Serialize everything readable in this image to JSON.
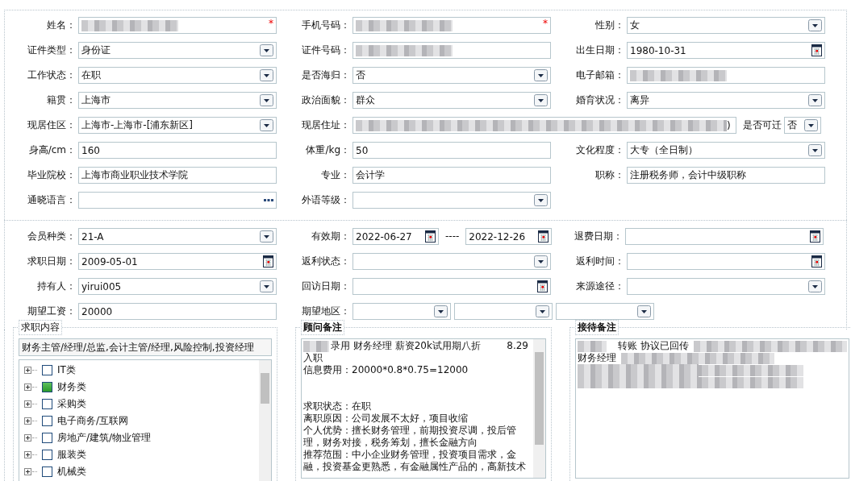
{
  "profile": {
    "rows": [
      {
        "cells": [
          {
            "label": "姓名：",
            "fields": [
              {
                "kind": "text",
                "redacted": true,
                "required_mark": "*"
              }
            ]
          },
          {
            "label": "手机号码：",
            "fields": [
              {
                "kind": "text",
                "redacted": true,
                "required_mark": "*"
              }
            ]
          },
          {
            "label": "性别：",
            "fields": [
              {
                "kind": "select",
                "value": "女"
              }
            ]
          }
        ]
      },
      {
        "cells": [
          {
            "label": "证件类型：",
            "fields": [
              {
                "kind": "select",
                "value": "身份证"
              }
            ]
          },
          {
            "label": "证件号码：",
            "fields": [
              {
                "kind": "text",
                "redacted": true
              }
            ]
          },
          {
            "label": "出生日期：",
            "fields": [
              {
                "kind": "date",
                "value": "1980-10-31"
              }
            ]
          }
        ]
      },
      {
        "cells": [
          {
            "label": "工作状态：",
            "fields": [
              {
                "kind": "select",
                "value": "在职"
              }
            ]
          },
          {
            "label": "是否海归：",
            "fields": [
              {
                "kind": "select",
                "value": "否"
              }
            ]
          },
          {
            "label": "电子邮箱：",
            "fields": [
              {
                "kind": "text",
                "redacted": true
              }
            ]
          }
        ]
      },
      {
        "cells": [
          {
            "label": "籍贯：",
            "fields": [
              {
                "kind": "select",
                "value": "上海市"
              }
            ]
          },
          {
            "label": "政治面貌：",
            "fields": [
              {
                "kind": "select",
                "value": "群众"
              }
            ]
          },
          {
            "label": "婚育状况：",
            "fields": [
              {
                "kind": "select",
                "value": "离异"
              }
            ]
          }
        ]
      },
      {
        "cells": [
          {
            "label": "现居住区：",
            "fields": [
              {
                "kind": "select",
                "value": " 上海市-上海市-[浦东新区]"
              }
            ]
          },
          {
            "label": "现居住址：",
            "fields": [
              {
                "kind": "text",
                "redacted": true,
                "value": ")"
              }
            ],
            "extra": {
              "label": "是否可迁",
              "field": {
                "kind": "select",
                "value": "否"
              }
            }
          }
        ]
      },
      {
        "cells": [
          {
            "label": "身高/cm：",
            "fields": [
              {
                "kind": "text",
                "value": "160"
              }
            ]
          },
          {
            "label": "体重/kg：",
            "fields": [
              {
                "kind": "text",
                "value": "50"
              }
            ]
          },
          {
            "label": "文化程度：",
            "fields": [
              {
                "kind": "select",
                "value": "大专（全日制）"
              }
            ]
          }
        ]
      },
      {
        "cells": [
          {
            "label": "毕业院校：",
            "fields": [
              {
                "kind": "text",
                "value": "上海市商业职业技术学院"
              }
            ]
          },
          {
            "label": "专业：",
            "fields": [
              {
                "kind": "text",
                "value": "会计学"
              }
            ]
          },
          {
            "label": "职称：",
            "fields": [
              {
                "kind": "text",
                "value": "注册税务师，会计中级职称"
              }
            ]
          }
        ]
      },
      {
        "cells": [
          {
            "label": "通晓语言：",
            "fields": [
              {
                "kind": "lookup"
              }
            ]
          },
          {
            "label": "外语等级：",
            "fields": [
              {
                "kind": "select"
              }
            ]
          }
        ]
      }
    ]
  },
  "membership": {
    "rows": [
      {
        "cells": [
          {
            "label": "会员种类：",
            "fields": [
              {
                "kind": "select",
                "value": " 21-A"
              }
            ]
          },
          {
            "label": "有效期：",
            "fields": [
              {
                "kind": "date",
                "value": "2022-06-27"
              },
              {
                "kind": "separator",
                "value": "----"
              },
              {
                "kind": "date",
                "value": "2022-12-26"
              }
            ]
          },
          {
            "label": "退费日期：",
            "fields": [
              {
                "kind": "date"
              }
            ]
          }
        ]
      },
      {
        "cells": [
          {
            "label": "求职日期：",
            "fields": [
              {
                "kind": "date",
                "value": "2009-05-01"
              }
            ]
          },
          {
            "label": "返利状态：",
            "fields": [
              {
                "kind": "select"
              }
            ]
          },
          {
            "label": "返利时间：",
            "fields": [
              {
                "kind": "date"
              }
            ]
          }
        ]
      },
      {
        "cells": [
          {
            "label": "持有人：",
            "fields": [
              {
                "kind": "select",
                "value": "yirui005"
              }
            ]
          },
          {
            "label": "回访日期：",
            "fields": [
              {
                "kind": "date"
              }
            ]
          },
          {
            "label": "来源途径：",
            "fields": [
              {
                "kind": "select"
              }
            ]
          }
        ]
      },
      {
        "cells": [
          {
            "label": "期望工资：",
            "fields": [
              {
                "kind": "text",
                "value": "20000"
              }
            ]
          },
          {
            "label": "期望地区：",
            "fields": [
              {
                "kind": "select"
              },
              {
                "kind": "select"
              },
              {
                "kind": "select"
              }
            ]
          }
        ]
      }
    ]
  },
  "job_intent": {
    "legend": "求职内容",
    "summary": "财务主管/经理/总监,会计主管/经理,风险控制,投资经理",
    "tree": [
      {
        "label": "IT类",
        "expanded": false,
        "checked": false
      },
      {
        "label": "财务类",
        "expanded": false,
        "checked": true
      },
      {
        "label": "采购类",
        "expanded": false,
        "checked": false
      },
      {
        "label": "电子商务/互联网",
        "expanded": false,
        "checked": false
      },
      {
        "label": "房地产/建筑/物业管理",
        "expanded": false,
        "checked": false
      },
      {
        "label": "服装类",
        "expanded": false,
        "checked": false
      },
      {
        "label": "机械类",
        "expanded": false,
        "checked": false
      }
    ]
  },
  "advisor_notes": {
    "legend": "顾问备注",
    "lines": [
      {
        "kind": "text",
        "redacted_before": true,
        "text": "录用 财务经理 薪资20k试用期八折",
        "aside": "8.29"
      },
      {
        "kind": "text",
        "text": "入职"
      },
      {
        "kind": "text",
        "text": "信息费用：20000*0.8*0.75=12000"
      },
      {
        "kind": "blank"
      },
      {
        "kind": "blank"
      },
      {
        "kind": "text",
        "text": "求职状态：在职"
      },
      {
        "kind": "text",
        "text": "离职原因：公司发展不太好，项目收缩"
      },
      {
        "kind": "text",
        "text": "个人优势：擅长财务管理，前期投资尽调，投后管"
      },
      {
        "kind": "text",
        "text": "理，财务对接，税务筹划，擅长金融方向"
      },
      {
        "kind": "text",
        "text": "推荐范围：中小企业财务管理，投资项目需求，金"
      },
      {
        "kind": "text",
        "text": "融，投资基金更熟悉，有金融属性产品的，高新技术"
      }
    ]
  },
  "reception_notes": {
    "legend": "接待备注",
    "lines": [
      {
        "kind": "text",
        "redacted_before": true,
        "text": "转账 协议已回传",
        "redacted_after": true
      },
      {
        "kind": "text",
        "text": "财务经理",
        "redacted_after": true
      },
      {
        "kind": "redacted"
      },
      {
        "kind": "redacted"
      }
    ]
  }
}
